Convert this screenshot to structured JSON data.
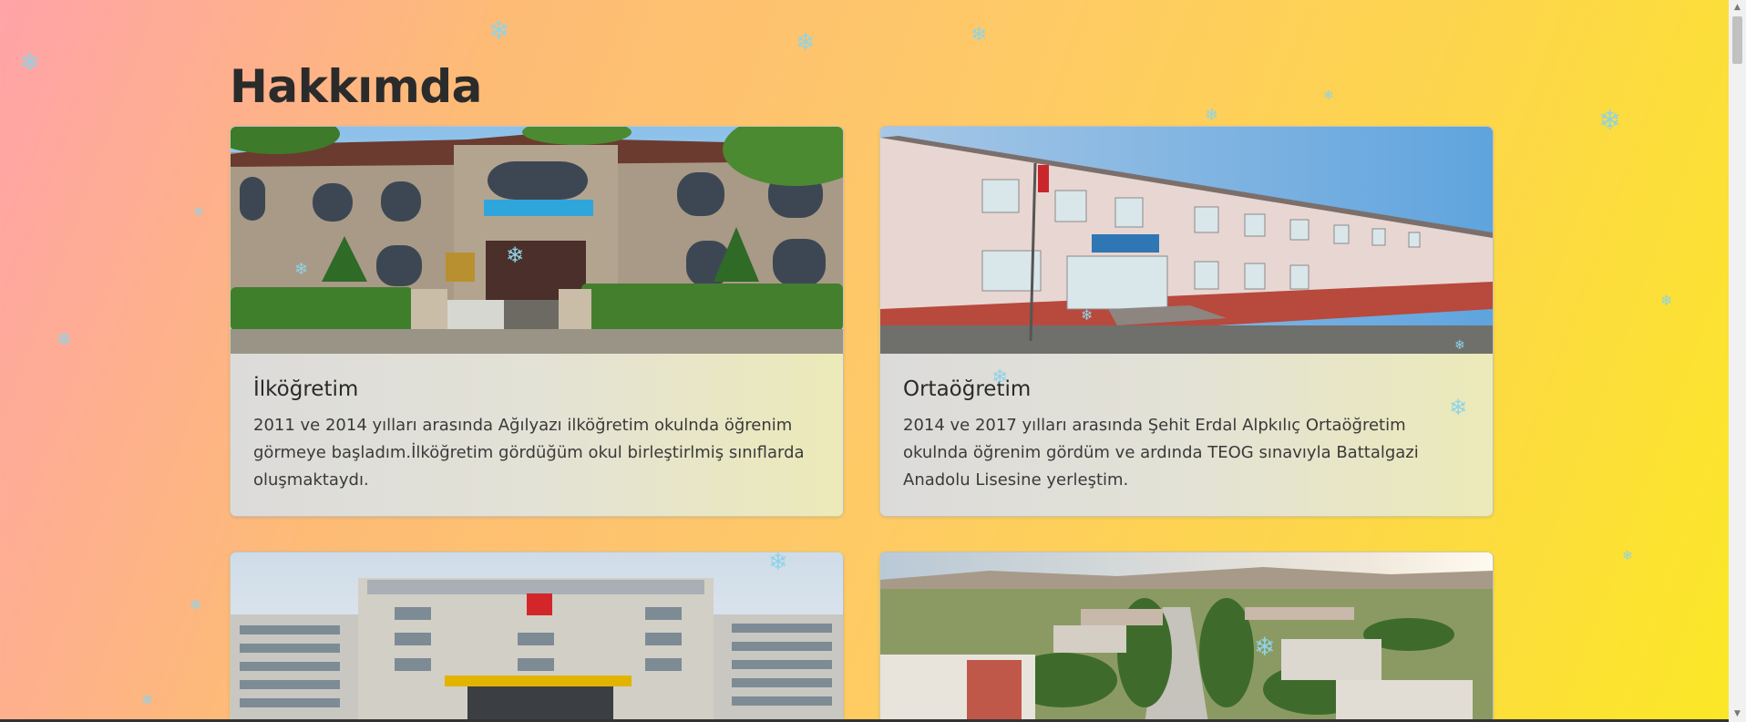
{
  "page": {
    "title": "Hakkımda"
  },
  "cards": [
    {
      "title": "İlköğretim",
      "text": "2011 ve 2014 yılları arasında Ağılyazı ilköğretim okulnda öğrenim görmeye başladım.İlköğretim gördüğüm okul birleştirlmiş sınıflarda oluşmaktaydı.",
      "image": "primary-school-photo"
    },
    {
      "title": "Ortaöğretim",
      "text": "2014 ve 2017 yılları arasında Şehit Erdal Alpkılıç Ortaöğretim okulnda öğrenim gördüm ve ardında TEOG sınavıyla Battalgazi Anadolu Lisesine yerleştim.",
      "image": "middle-school-photo"
    },
    {
      "image": "high-school-photo"
    },
    {
      "image": "university-campus-photo"
    }
  ],
  "decoration": {
    "snowflake_glyph": "❄",
    "snowflake_color": "#8fd3e6"
  },
  "colors": {
    "gradient_start": "#ffa3a8",
    "gradient_end": "#fbe825",
    "card_background": "#e3e2d6"
  }
}
